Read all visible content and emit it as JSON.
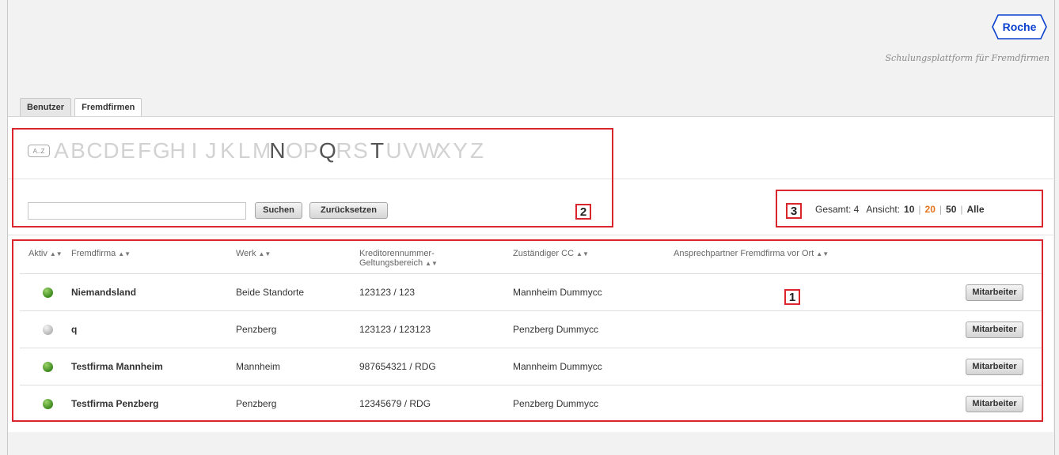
{
  "header": {
    "logo_text": "Roche",
    "tagline": "Schulungsplattform für Fremdfirmen"
  },
  "tabs": [
    {
      "label": "Benutzer",
      "active": false
    },
    {
      "label": "Fremdfirmen",
      "active": true
    }
  ],
  "alphabet": {
    "icon_text": "A..Z",
    "letters": [
      "A",
      "B",
      "C",
      "D",
      "E",
      "F",
      "G",
      "H",
      "I",
      "J",
      "K",
      "L",
      "M",
      "N",
      "O",
      "P",
      "Q",
      "R",
      "S",
      "T",
      "U",
      "V",
      "W",
      "X",
      "Y",
      "Z"
    ],
    "active_letters": [
      "N",
      "Q",
      "T"
    ]
  },
  "search": {
    "input_value": "",
    "search_label": "Suchen",
    "reset_label": "Zurücksetzen"
  },
  "paging": {
    "total_label": "Gesamt: 4",
    "view_label": "Ansicht:",
    "options": [
      "10",
      "20",
      "50",
      "Alle"
    ],
    "selected": "20",
    "separator": "|"
  },
  "table": {
    "headers": {
      "aktiv": "Aktiv",
      "fremdfirma": "Fremdfirma",
      "werk": "Werk",
      "kreditor_line1": "Kreditorennummer-",
      "kreditor_line2": "Geltungsbereich",
      "cc": "Zuständiger CC",
      "ansprechpartner": "Ansprechpartner Fremdfirma vor Ort"
    },
    "sort_glyph": "▲▼",
    "rows": [
      {
        "active": true,
        "fremdfirma": "Niemandsland",
        "werk": "Beide Standorte",
        "kreditor": "123123 / 123",
        "cc": "Mannheim Dummycc",
        "ansprechpartner": "",
        "button": "Mitarbeiter"
      },
      {
        "active": false,
        "fremdfirma": "q",
        "werk": "Penzberg",
        "kreditor": "123123 / 123123",
        "cc": "Penzberg Dummycc",
        "ansprechpartner": "",
        "button": "Mitarbeiter"
      },
      {
        "active": true,
        "fremdfirma": "Testfirma Mannheim",
        "werk": "Mannheim",
        "kreditor": "987654321 / RDG",
        "cc": "Mannheim Dummycc",
        "ansprechpartner": "",
        "button": "Mitarbeiter"
      },
      {
        "active": true,
        "fremdfirma": "Testfirma Penzberg",
        "werk": "Penzberg",
        "kreditor": "12345679 / RDG",
        "cc": "Penzberg Dummycc",
        "ansprechpartner": "",
        "button": "Mitarbeiter"
      }
    ]
  },
  "annotations": [
    "1",
    "2",
    "3"
  ],
  "colors": {
    "annotation": "#d9262c",
    "roche_blue": "#0b41cd",
    "selected_page": "#e8741d",
    "active_green": "#3d8a1e"
  }
}
